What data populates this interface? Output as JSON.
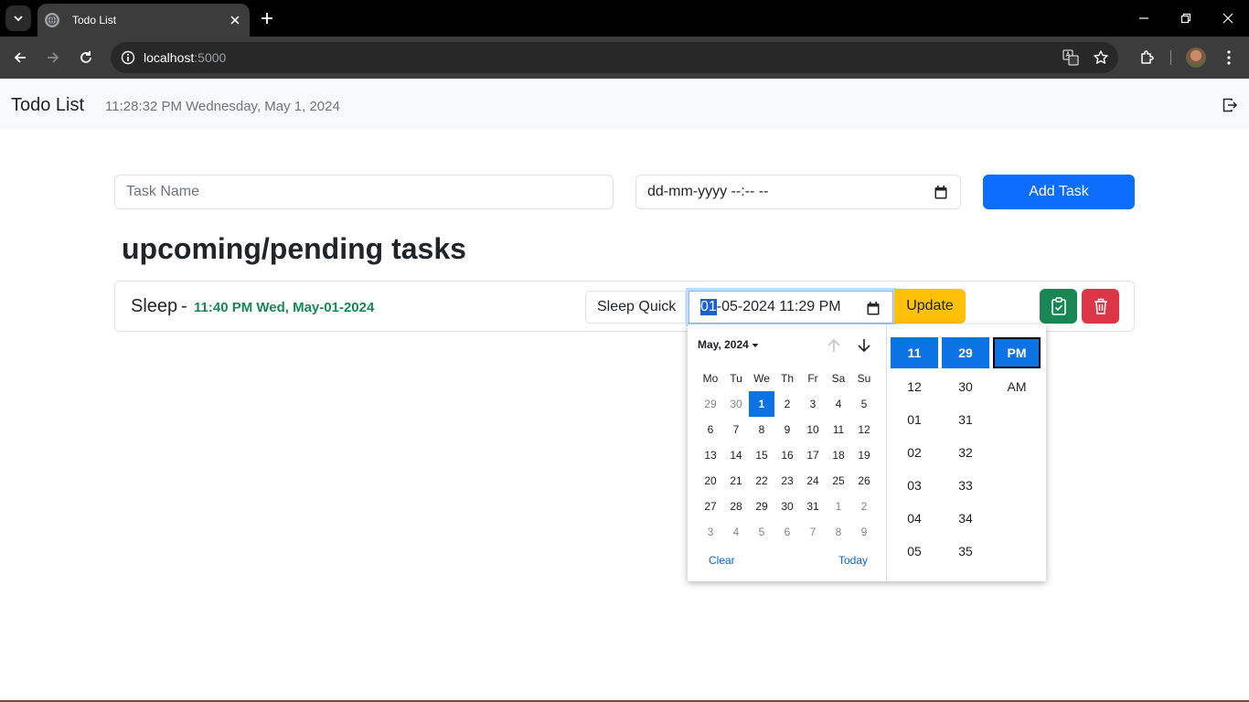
{
  "browser": {
    "tab_title": "Todo List",
    "url_host": "localhost",
    "url_port": ":5000"
  },
  "navbar": {
    "brand": "Todo List",
    "clock": "11:28:32 PM Wednesday, May 1, 2024"
  },
  "form": {
    "task_placeholder": "Task Name",
    "due_placeholder": "dd-mm-yyyy --:-- --",
    "add_label": "Add Task"
  },
  "section_title": "upcoming/pending tasks",
  "task": {
    "name": "Sleep",
    "dash": "-",
    "due": "11:40 PM Wed, May-01-2024",
    "edit_name": "Sleep Quick",
    "edit_date_selected": "01",
    "edit_date_rest": "-05-2024 11:29  PM",
    "update_label": "Update"
  },
  "picker": {
    "month_label": "May, 2024",
    "weekdays": [
      "Mo",
      "Tu",
      "We",
      "Th",
      "Fr",
      "Sa",
      "Su"
    ],
    "days": [
      {
        "d": "29",
        "m": true
      },
      {
        "d": "30",
        "m": true
      },
      {
        "d": "1",
        "s": true
      },
      {
        "d": "2"
      },
      {
        "d": "3"
      },
      {
        "d": "4"
      },
      {
        "d": "5"
      },
      {
        "d": "6"
      },
      {
        "d": "7"
      },
      {
        "d": "8"
      },
      {
        "d": "9"
      },
      {
        "d": "10"
      },
      {
        "d": "11"
      },
      {
        "d": "12"
      },
      {
        "d": "13"
      },
      {
        "d": "14"
      },
      {
        "d": "15"
      },
      {
        "d": "16"
      },
      {
        "d": "17"
      },
      {
        "d": "18"
      },
      {
        "d": "19"
      },
      {
        "d": "20"
      },
      {
        "d": "21"
      },
      {
        "d": "22"
      },
      {
        "d": "23"
      },
      {
        "d": "24"
      },
      {
        "d": "25"
      },
      {
        "d": "26"
      },
      {
        "d": "27"
      },
      {
        "d": "28"
      },
      {
        "d": "29"
      },
      {
        "d": "30"
      },
      {
        "d": "31"
      },
      {
        "d": "1",
        "m": true
      },
      {
        "d": "2",
        "m": true
      },
      {
        "d": "3",
        "m": true
      },
      {
        "d": "4",
        "m": true
      },
      {
        "d": "5",
        "m": true
      },
      {
        "d": "6",
        "m": true
      },
      {
        "d": "7",
        "m": true
      },
      {
        "d": "8",
        "m": true
      },
      {
        "d": "9",
        "m": true
      }
    ],
    "clear_label": "Clear",
    "today_label": "Today",
    "hours": [
      "11",
      "12",
      "01",
      "02",
      "03",
      "04",
      "05"
    ],
    "minutes": [
      "29",
      "30",
      "31",
      "32",
      "33",
      "34",
      "35"
    ],
    "ampm": [
      "PM",
      "AM"
    ]
  },
  "colors": {
    "primary": "#0d6efd",
    "success": "#198754",
    "danger": "#dc3545",
    "warning": "#ffc107"
  }
}
